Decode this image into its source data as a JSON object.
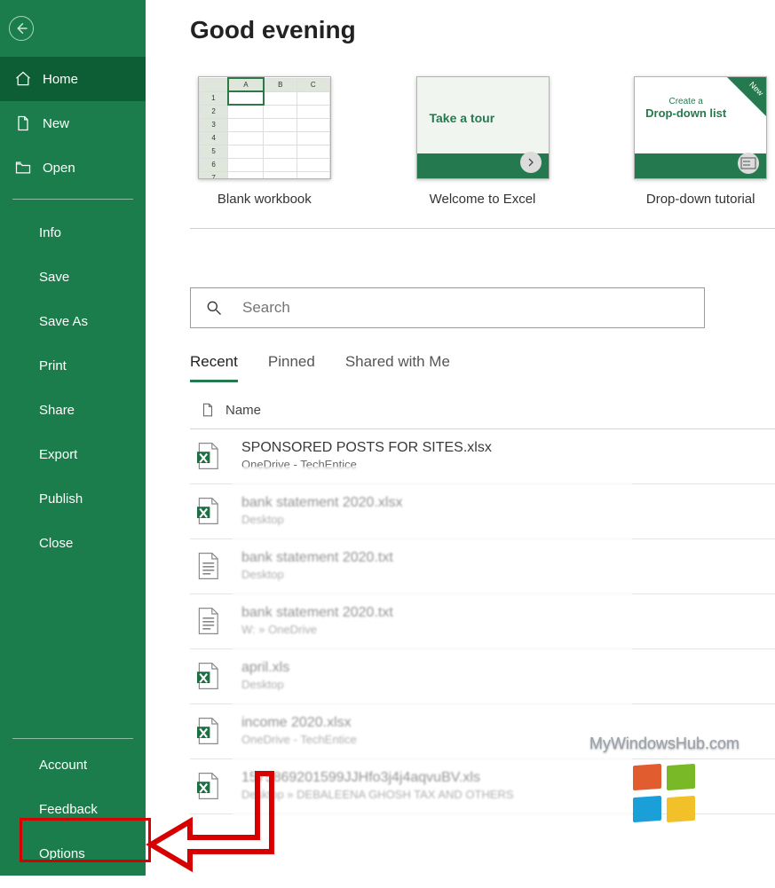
{
  "header": {
    "title": "Good evening"
  },
  "sidebar": {
    "nav": [
      {
        "label": "Home",
        "icon": "home"
      },
      {
        "label": "New",
        "icon": "file"
      },
      {
        "label": "Open",
        "icon": "open"
      }
    ],
    "menu": [
      {
        "label": "Info"
      },
      {
        "label": "Save"
      },
      {
        "label": "Save As"
      },
      {
        "label": "Print"
      },
      {
        "label": "Share"
      },
      {
        "label": "Export"
      },
      {
        "label": "Publish"
      },
      {
        "label": "Close"
      }
    ],
    "bottom": [
      {
        "label": "Account"
      },
      {
        "label": "Feedback"
      },
      {
        "label": "Options"
      }
    ]
  },
  "templates": [
    {
      "label": "Blank workbook"
    },
    {
      "label": "Welcome to Excel",
      "tour_text": "Take a tour"
    },
    {
      "label": "Drop-down tutorial",
      "badge": "New",
      "title_small": "Create a",
      "title_big": "Drop-down list"
    }
  ],
  "search": {
    "placeholder": "Search"
  },
  "tabs": [
    {
      "label": "Recent",
      "active": true
    },
    {
      "label": "Pinned"
    },
    {
      "label": "Shared with Me"
    }
  ],
  "list": {
    "header_name": "Name"
  },
  "files": [
    {
      "name": "SPONSORED POSTS FOR SITES.xlsx",
      "location": "OneDrive - TechEntice",
      "type": "xlsx"
    },
    {
      "name": "bank statement 2020.xlsx",
      "location": "Desktop",
      "type": "xlsx"
    },
    {
      "name": "bank statement 2020.txt",
      "location": "Desktop",
      "type": "txt"
    },
    {
      "name": "bank statement 2020.txt",
      "location": "W: » OneDrive",
      "type": "txt"
    },
    {
      "name": "april.xls",
      "location": "Desktop",
      "type": "xlsx"
    },
    {
      "name": "income 2020.xlsx",
      "location": "OneDrive - TechEntice",
      "type": "xlsx"
    },
    {
      "name": "1575869201599JJHfo3j4j4aqvuBV.xls",
      "location": "Desktop » DEBALEENA GHOSH TAX AND OTHERS",
      "type": "xlsx"
    }
  ],
  "watermark": "MyWindowsHub.com",
  "colors": {
    "brand_green": "#1a7d4b",
    "accent_green": "#247a4e",
    "highlight_red": "#d60000"
  }
}
